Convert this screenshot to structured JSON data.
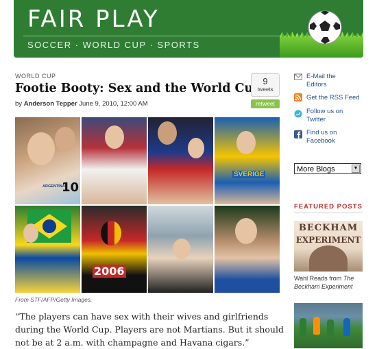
{
  "header": {
    "title": "FAIR PLAY",
    "subtitle": "SOCCER · WORLD CUP · SPORTS"
  },
  "article": {
    "kicker": "WORLD CUP",
    "headline": "Footie Booty: Sex and the World Cup",
    "byline_prefix": "by",
    "author": "Anderson Tepper",
    "date": "June 9, 2010, 12:00 AM",
    "photo_caption": "From STF/AFP/Getty Images.",
    "quote": "“The players can have sex with their wives and girlfriends during the World Cup. Players are not Martians. But it should not be at 2 a.m. with champagne and Havana cigars.”",
    "photo_text": {
      "jersey_argentina": "ARGENTINA",
      "jersey_number": "10",
      "sverige": "SVERIGE",
      "shirt_2006": "2006"
    }
  },
  "tweet": {
    "count": "9",
    "label": "tweets",
    "retweet_label": "retweet"
  },
  "sidebar": {
    "links": [
      {
        "icon": "email-icon",
        "label": "E-Mail the Editors"
      },
      {
        "icon": "rss-icon",
        "label": "Get the RSS Feed"
      },
      {
        "icon": "twitter-icon",
        "label": "Follow us on Twitter"
      },
      {
        "icon": "facebook-icon",
        "label": "Find us on Facebook"
      }
    ],
    "more_blogs": "More Blogs",
    "featured_title": "FEATURED POSTS",
    "featured": {
      "image_line1": "BECKHAM",
      "image_line2": "EXPERIMENT",
      "caption_prefix": "Wahl Reads from ",
      "caption_italic": "The Beckham Experiment"
    }
  },
  "colors": {
    "banner_green": "#2e7d32",
    "link_blue": "#1f4e8c",
    "featured_red": "#c62828",
    "retweet_green": "#8bc34a"
  }
}
